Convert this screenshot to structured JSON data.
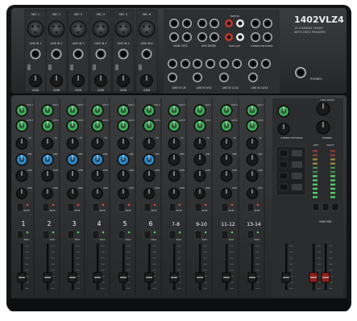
{
  "brand": {
    "model": "1402VLZ4",
    "tagline_1": "14-CHANNEL MIXER",
    "tagline_2": "WITH ONYX PREAMPS"
  },
  "mic_labels": [
    "MIC 1",
    "MIC 2",
    "MIC 3",
    "MIC 4",
    "MIC 5",
    "MIC 6"
  ],
  "line_labels": [
    "LINE IN 1",
    "LINE IN 2",
    "LINE IN 3",
    "LINE IN 4",
    "LINE IN 5",
    "LINE IN 6"
  ],
  "rear_labels": {
    "main_outs": "MAIN OUTS",
    "aux_sends": "AUX SENDS",
    "tape_in": "TAPE IN",
    "tape_out": "TAPE OUT",
    "stereo_returns": "STEREO RETURNS",
    "line_in_7_8": "LINE IN 7/8",
    "line_in_9_10": "LINE IN 9/10",
    "line_in_11_12": "LINE IN 11/12",
    "line_in_13_14": "LINE IN 13/14",
    "phones": "PHONES"
  },
  "channel_numbers": [
    "1",
    "2",
    "3",
    "4",
    "5",
    "6",
    "7-8",
    "9-10",
    "11-12",
    "13-14"
  ],
  "strip_labels": {
    "gain": "GAIN",
    "aux_1": "AUX 1",
    "aux_2": "AUX 2",
    "hi": "HI",
    "mid": "MID",
    "low": "LOW",
    "pan": "PAN",
    "mute": "MUTE",
    "solo": "SOLO"
  },
  "master_labels": {
    "ctrl_room": "CTRL ROOM",
    "main_mix": "MAIN MIX",
    "phones": "PHONES",
    "stereo_returns": "STEREO RETURNS",
    "left": "LEFT",
    "right": "RIGHT"
  },
  "colors": {
    "panel": "#2b2d2f",
    "panel_edge": "#111213",
    "knob_green": "#3fae5a",
    "knob_blue": "#2f8fd0",
    "knob_black": "#1a1a1a",
    "meter_green": "#5bd36a",
    "meter_yellow": "#e5d34a",
    "meter_red": "#e04b3b"
  }
}
